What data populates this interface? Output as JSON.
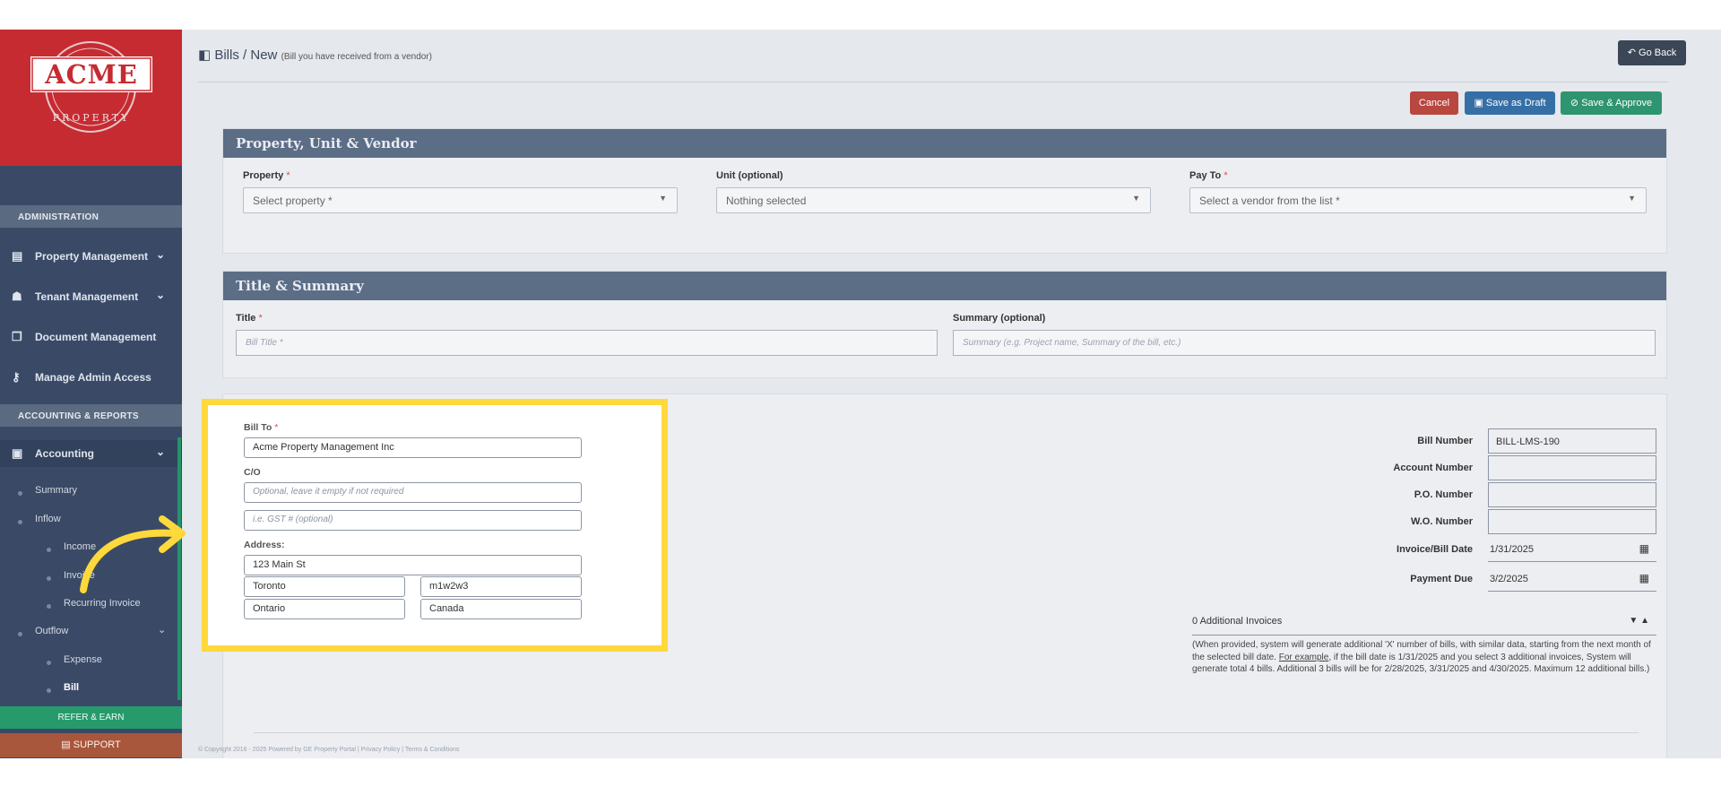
{
  "brand": {
    "name": "ACME",
    "tagline": "PROPERTY"
  },
  "sidebar": {
    "sections": [
      "ADMINISTRATION",
      "ACCOUNTING & REPORTS"
    ],
    "items": [
      {
        "label": "Property Management",
        "icon": "building-icon"
      },
      {
        "label": "Tenant Management",
        "icon": "users-icon"
      },
      {
        "label": "Document Management",
        "icon": "documents-icon"
      },
      {
        "label": "Manage Admin Access",
        "icon": "key-icon"
      },
      {
        "label": "Accounting",
        "icon": "money-icon"
      }
    ],
    "sub": {
      "summary": "Summary",
      "inflow": "Inflow",
      "income": "Income",
      "invoice": "Invoice",
      "recurring": "Recurring Invoice",
      "outflow": "Outflow",
      "expense": "Expense",
      "bill": "Bill"
    },
    "refer": "REFER & EARN",
    "support": "SUPPORT"
  },
  "header": {
    "section": "Bills",
    "slash": "/",
    "page": "New",
    "subtitle": "(Bill you have received from a vendor)",
    "go_back": "Go Back"
  },
  "actions": {
    "cancel": "Cancel",
    "draft": "Save as Draft",
    "approve": "Save & Approve"
  },
  "panel1": {
    "title": "Property, Unit & Vendor",
    "property_label": "Property",
    "property_value": "Select property *",
    "unit_label": "Unit (optional)",
    "unit_value": "Nothing selected",
    "payto_label": "Pay To",
    "payto_value": "Select a vendor from the list *"
  },
  "panel2": {
    "title": "Title & Summary",
    "title_label": "Title",
    "title_placeholder": "Bill Title *",
    "summary_label": "Summary (optional)",
    "summary_placeholder": "Summary (e.g. Project name, Summary of the bill, etc.)"
  },
  "billto": {
    "label": "Bill To",
    "name": "Acme Property Management Inc",
    "co_label": "C/O",
    "co_placeholder": "Optional, leave it empty if not required",
    "gst_placeholder": "i.e. GST # (optional)",
    "address_label": "Address:",
    "street": "123 Main St",
    "city": "Toronto",
    "postal": "m1w2w3",
    "province": "Ontario",
    "country": "Canada"
  },
  "bill_fields": [
    {
      "label": "Bill Number",
      "value": "BILL-LMS-190"
    },
    {
      "label": "Account Number",
      "value": ""
    },
    {
      "label": "P.O. Number",
      "value": ""
    },
    {
      "label": "W.O. Number",
      "value": ""
    },
    {
      "label": "Invoice/Bill Date",
      "value": "1/31/2025"
    },
    {
      "label": "Payment Due",
      "value": "3/2/2025"
    }
  ],
  "additional": {
    "label": "0 Additional Invoices",
    "note_a": "(When provided, system will generate additional 'X' number of bills, with similar data, starting from the next month of the selected bill date. ",
    "note_link": "For example",
    "note_b": ", if the bill date is 1/31/2025 and you select 3 additional invoices, System will generate total 4 bills. Additional 3 bills will be for 2/28/2025, 3/31/2025 and 4/30/2025. Maximum 12 additional bills.)"
  },
  "footer": {
    "text": "© Copyright 2016 - 2025 Powered by GE Property Portal | Privacy Policy | Terms & Conditions"
  },
  "colors": {
    "sidebar": "#3a4a66",
    "logo_bg": "#c62b32",
    "cancel": "#c9302c",
    "draft": "#2a6fb0",
    "approve": "#27a06d",
    "highlight": "#ffd83c"
  }
}
